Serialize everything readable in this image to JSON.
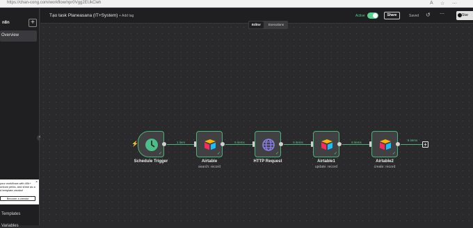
{
  "browser": {
    "url": "https://chan-cong.com/workflow/npr0Vgg2EUkCleh",
    "icons": [
      "reader-icon",
      "favorite-icon",
      "menu-icon"
    ]
  },
  "sidebar": {
    "logo": "n8n",
    "add_symbol": "+",
    "overview": "Overview",
    "promo": {
      "line1": "your workflows with 40k+",
      "line2": "unlock perks, and shine as a",
      "line3": "d template creator!",
      "button": "Become a creator",
      "close": "×"
    },
    "templates": "Templates",
    "variables": "Variables"
  },
  "header": {
    "title": "Tạo task Planeasana (IT+System)",
    "add_tag": "+ Add tag",
    "active_label": "Active",
    "active": true,
    "share": "Share",
    "saved": "Saved",
    "star_label": "Star"
  },
  "tabs": {
    "editor": "Editor",
    "executions": "Executions",
    "selected": "editor"
  },
  "workflow": {
    "nodes": [
      {
        "label": "Schedule Trigger",
        "sub": "",
        "icon": "clock-icon",
        "type": "trigger"
      },
      {
        "label": "Airtable",
        "sub": "search: record",
        "icon": "airtable-icon",
        "type": "action"
      },
      {
        "label": "HTTP Request",
        "sub": "",
        "icon": "globe-icon",
        "type": "action"
      },
      {
        "label": "Airtable1",
        "sub": "update: record",
        "icon": "airtable-icon",
        "type": "action"
      },
      {
        "label": "Airtable2",
        "sub": "create: record",
        "icon": "airtable-icon",
        "type": "action"
      }
    ],
    "connections": [
      "1 item",
      "6 items",
      "6 items",
      "6 items",
      "6 items"
    ],
    "status": "success",
    "colors": {
      "success": "#4fd08a",
      "node_border": "#46b779",
      "trigger_icon": "#4cbf89",
      "lightning": "#f06a3a"
    }
  }
}
